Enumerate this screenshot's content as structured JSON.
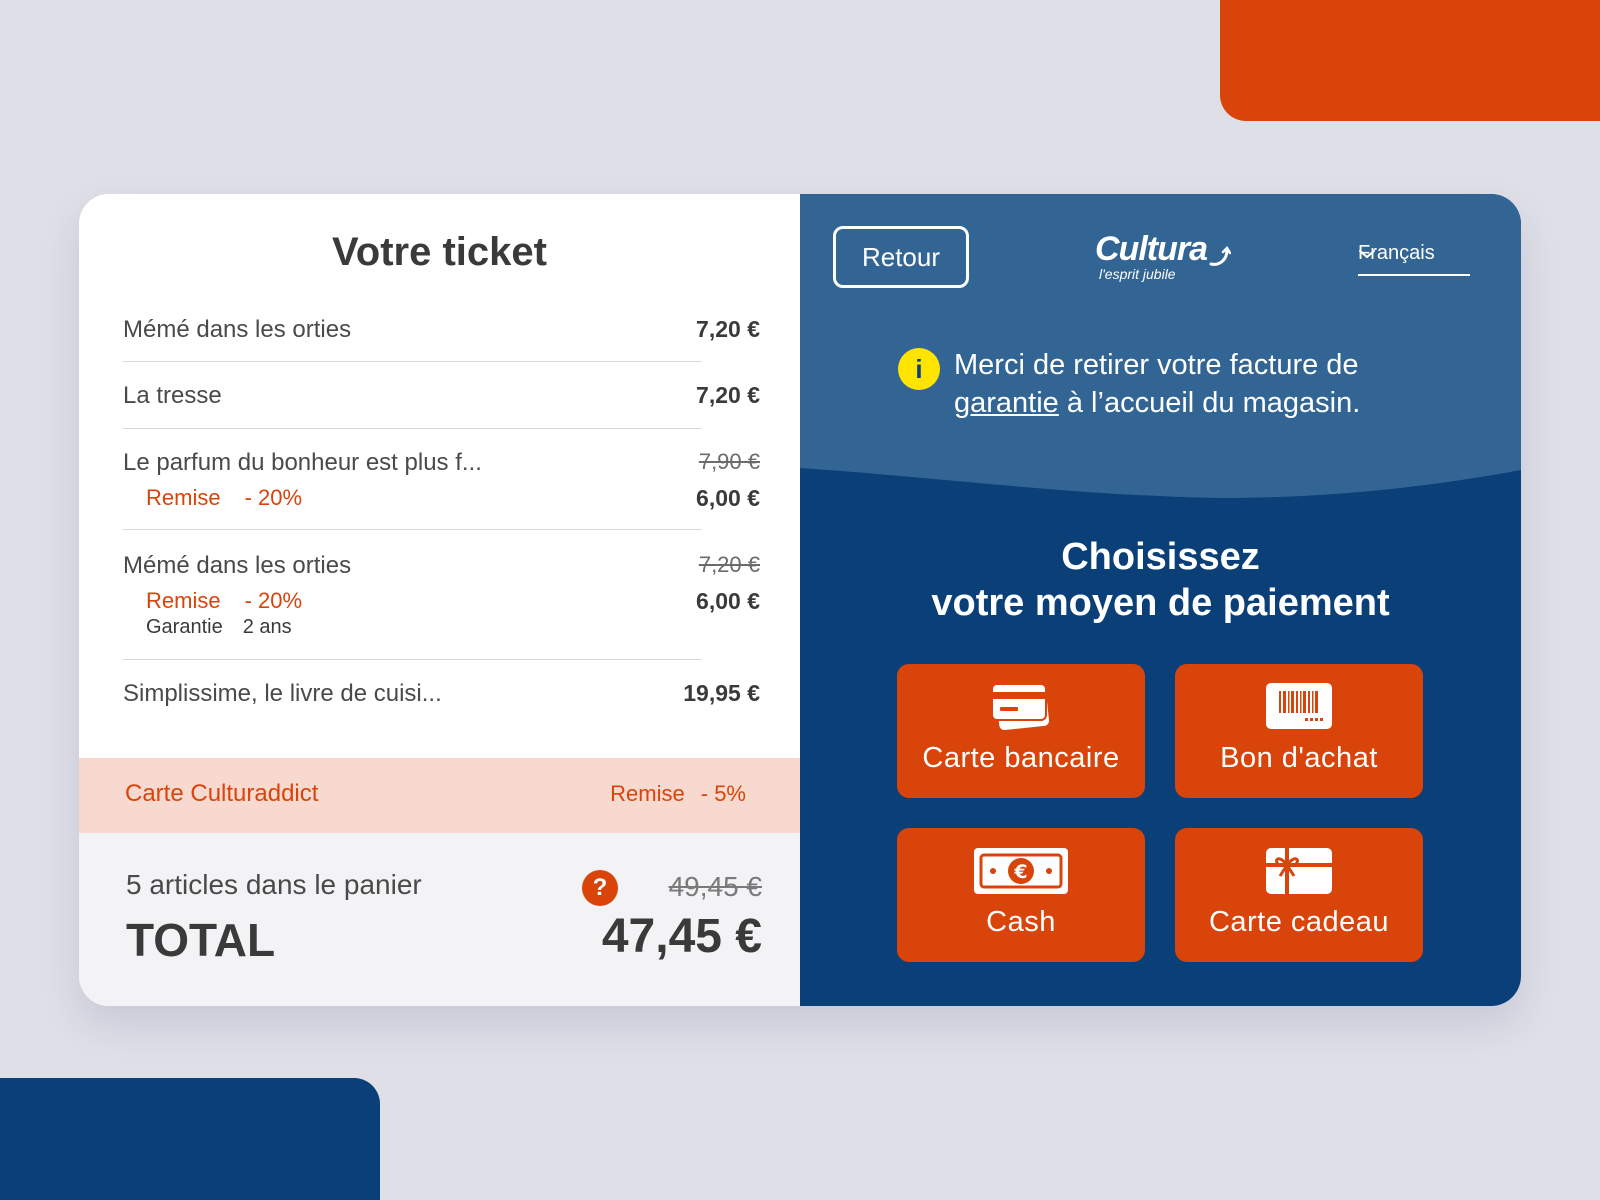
{
  "colors": {
    "brand_orange": "#d9440a",
    "brand_blue": "#0a3f78",
    "light_blue": "#336594",
    "promo_bg": "#f7d9cf",
    "info_yellow": "#ffe400"
  },
  "ticket": {
    "title": "Votre ticket",
    "items": [
      {
        "name": "Mémé dans les orties",
        "price": "7,20 €"
      },
      {
        "name": "La tresse",
        "price": "7,20 €"
      },
      {
        "name": "Le parfum du bonheur est plus f...",
        "old_price": "7,90 €",
        "remise_label": "Remise",
        "remise_value": "- 20%",
        "new_price": "6,00 €"
      },
      {
        "name": "Mémé dans les orties",
        "old_price": "7,20 €",
        "remise_label": "Remise",
        "remise_value": "- 20%",
        "new_price": "6,00 €",
        "garantie_label": "Garantie",
        "garantie_value": "2 ans"
      },
      {
        "name": "Simplissime, le livre de cuisi...",
        "price": "19,95 €"
      }
    ],
    "loyalty": {
      "label": "Carte Culturaddict",
      "remise_label": "Remise",
      "remise_value": "- 5%"
    },
    "summary": {
      "count": "5 articles dans le panier",
      "total_label": "TOTAL",
      "help": "?",
      "old_total": "49,45 €",
      "total": "47,45 €"
    }
  },
  "payment": {
    "back_label": "Retour",
    "logo": {
      "brand": "Cultura",
      "tagline": "l'esprit jubile"
    },
    "language": "Français",
    "notice": {
      "icon": "i",
      "before": "Merci de retirer votre facture de ",
      "link": "garantie",
      "after": " à l’accueil du magasin."
    },
    "title_line1": "Choisissez",
    "title_line2": "votre moyen de paiement",
    "methods": [
      {
        "label": "Carte bancaire",
        "icon": "credit-card-icon"
      },
      {
        "label": "Bon d'achat",
        "icon": "barcode-voucher-icon"
      },
      {
        "label": "Cash",
        "icon": "banknote-icon"
      },
      {
        "label": "Carte cadeau",
        "icon": "gift-card-icon"
      }
    ]
  }
}
